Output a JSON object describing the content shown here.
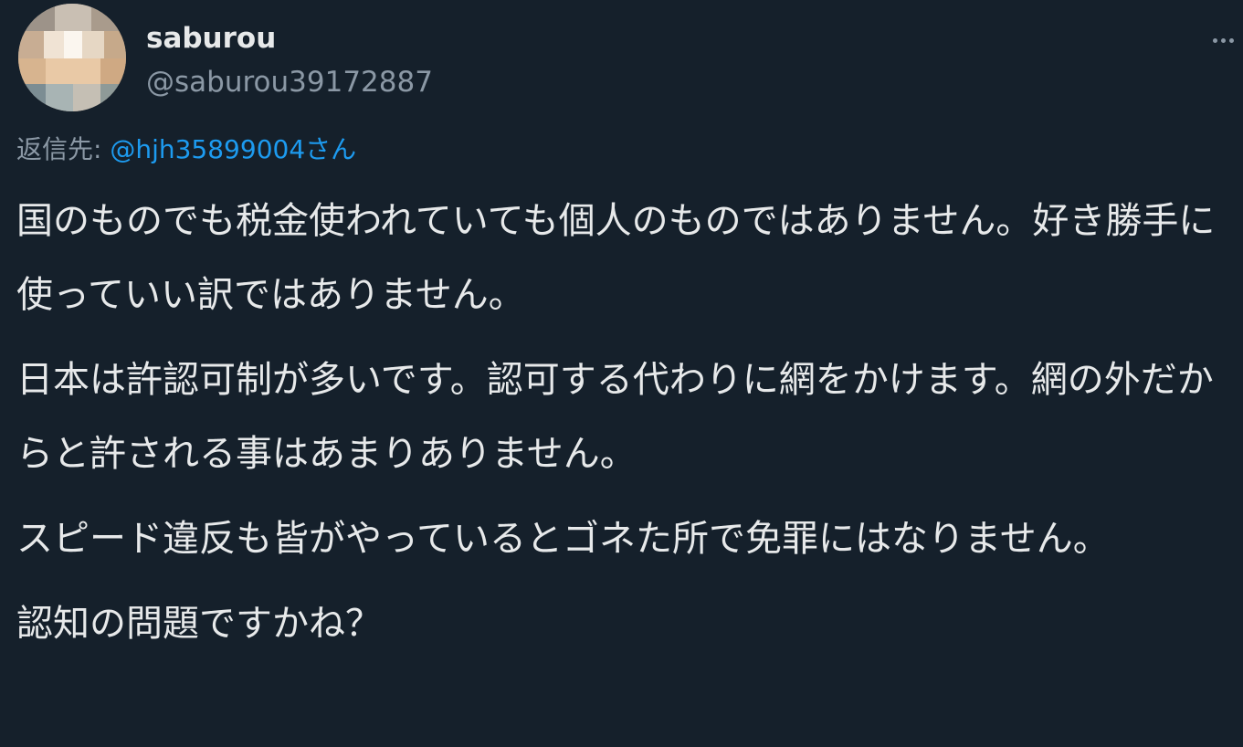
{
  "post": {
    "author_name": "saburou",
    "author_handle": "@saburou39172887",
    "more_icon": "ellipsis-icon",
    "avatar_icon": "pixelated-avatar",
    "reply": {
      "label": "返信先: ",
      "target": "@hjh35899004さん"
    },
    "paragraphs": [
      "国のものでも税金使われていても個人のものではありません。好き勝手に使っていい訳ではありません。",
      "日本は許認可制が多いです。認可する代わりに網をかけます。網の外だからと許される事はあまりありません。",
      "スピード違反も皆がやっているとゴネた所で免罪にはなりません。",
      "認知の問題ですかね？"
    ]
  },
  "colors": {
    "background": "#15202b",
    "text": "#e7e9ea",
    "secondary": "#8b98a5",
    "link": "#1d9bf0"
  }
}
